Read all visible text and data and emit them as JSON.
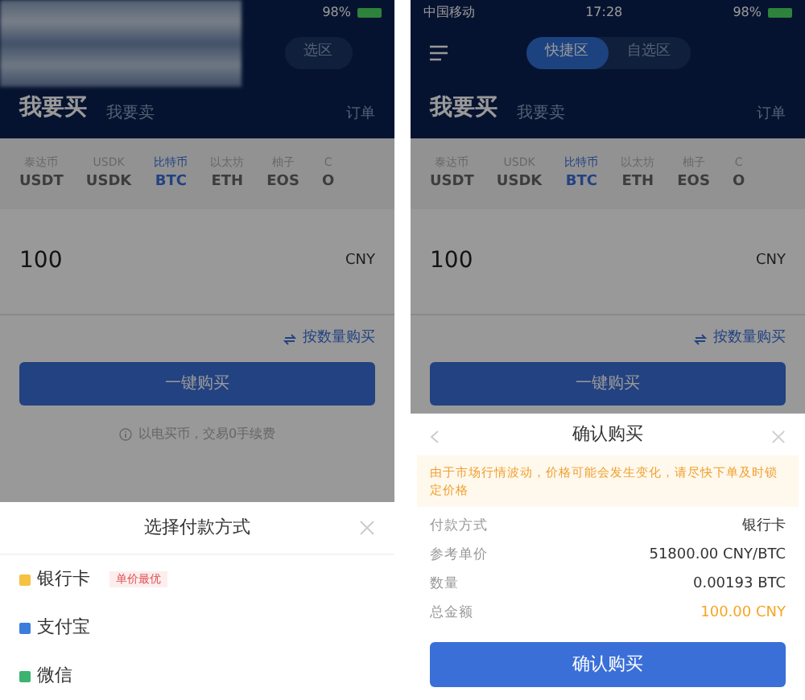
{
  "phones": [
    {
      "status": {
        "battery": "98%"
      },
      "redacted": true,
      "menu": false,
      "segments": [
        {
          "label": "选区",
          "selected": false
        }
      ],
      "tabs": [
        {
          "label": "我要买",
          "selected": true
        },
        {
          "label": "我要卖",
          "selected": false
        }
      ],
      "orders": "订单",
      "coins": [
        {
          "name": "泰达币",
          "symbol": "USDT",
          "selected": false
        },
        {
          "name": "USDK",
          "symbol": "USDK",
          "selected": false
        },
        {
          "name": "比特币",
          "symbol": "BTC",
          "selected": true
        },
        {
          "name": "以太坊",
          "symbol": "ETH",
          "selected": false
        },
        {
          "name": "柚子",
          "symbol": "EOS",
          "selected": false
        },
        {
          "name": "C",
          "symbol": "O",
          "selected": false
        }
      ],
      "amount": "100",
      "currency": "CNY",
      "switch_link": "按数量购买",
      "buy_button": "一键购买",
      "note": "以电买币，交易0手续费",
      "sheet": {
        "kind": "payment",
        "title": "选择付款方式",
        "methods": [
          {
            "label": "银行卡",
            "color": "#f5c242",
            "badge": "单价最优"
          },
          {
            "label": "支付宝",
            "color": "#3b7ddd"
          },
          {
            "label": "微信",
            "color": "#3cb371"
          }
        ]
      }
    },
    {
      "status": {
        "carrier": "中国移动",
        "time": "17:28",
        "battery": "98%"
      },
      "redacted": false,
      "menu": true,
      "segments": [
        {
          "label": "快捷区",
          "selected": true
        },
        {
          "label": "自选区",
          "selected": false
        }
      ],
      "tabs": [
        {
          "label": "我要买",
          "selected": true
        },
        {
          "label": "我要卖",
          "selected": false
        }
      ],
      "orders": "订单",
      "coins": [
        {
          "name": "泰达币",
          "symbol": "USDT",
          "selected": false
        },
        {
          "name": "USDK",
          "symbol": "USDK",
          "selected": false
        },
        {
          "name": "比特币",
          "symbol": "BTC",
          "selected": true
        },
        {
          "name": "以太坊",
          "symbol": "ETH",
          "selected": false
        },
        {
          "name": "柚子",
          "symbol": "EOS",
          "selected": false
        },
        {
          "name": "C",
          "symbol": "O",
          "selected": false
        }
      ],
      "amount": "100",
      "currency": "CNY",
      "switch_link": "按数量购买",
      "buy_button": "一键购买",
      "sheet": {
        "kind": "confirm",
        "title": "确认购买",
        "warning": "由于市场行情波动，价格可能会发生变化，请尽快下单及时锁定价格",
        "rows": [
          {
            "label": "付款方式",
            "value": "银行卡",
            "highlight": false
          },
          {
            "label": "参考单价",
            "value": "51800.00 CNY/BTC",
            "highlight": false
          },
          {
            "label": "数量",
            "value": "0.00193 BTC",
            "highlight": false
          },
          {
            "label": "总金额",
            "value": "100.00 CNY",
            "highlight": true
          }
        ],
        "confirm_button": "确认购买"
      }
    }
  ]
}
